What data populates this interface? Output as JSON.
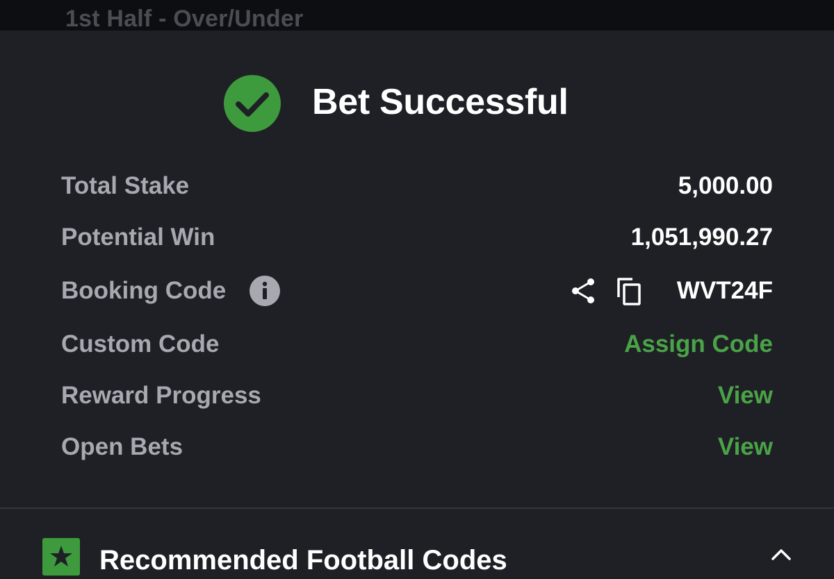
{
  "background": {
    "partial_text": "1st Half - Over/Under"
  },
  "modal": {
    "title": "Bet Successful",
    "icons": {
      "status": "check-circle-icon",
      "info": "info-icon",
      "share": "share-icon",
      "copy": "copy-icon",
      "star": "star-icon",
      "collapse": "chevron-up-icon"
    },
    "rows": [
      {
        "label": "Total Stake",
        "value": "5,000.00"
      },
      {
        "label": "Potential Win",
        "value": "1,051,990.27"
      },
      {
        "label": "Booking Code",
        "value": "WVT24F"
      },
      {
        "label": "Custom Code",
        "value": "Assign Code"
      },
      {
        "label": "Reward Progress",
        "value": "View"
      },
      {
        "label": "Open Bets",
        "value": "View"
      }
    ]
  },
  "recommended": {
    "title": "Recommended Football Codes"
  },
  "colors": {
    "sheet_background": "#1f2026",
    "accent_green": "#3d9b3d",
    "link_green": "#4aa347",
    "label_gray": "#a7a9b0",
    "value_white": "#ffffff"
  }
}
